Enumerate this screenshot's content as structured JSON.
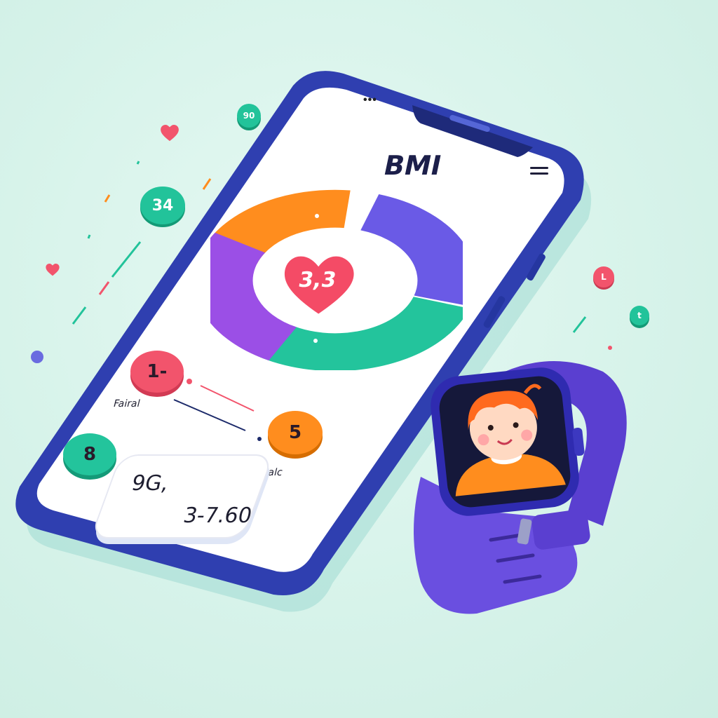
{
  "app": {
    "title": "BMI",
    "gauge_value": "3,3",
    "btn_left_top": "1-",
    "btn_right": "5",
    "btn_left_bottom": "8",
    "label_left": "Fairal",
    "label_right": "Ribalc",
    "readout_a": "9G,",
    "readout_b": "3-7.60"
  },
  "floaters": {
    "teal_small": "90",
    "teal_big": "34",
    "red_small": "L",
    "teal_right": "t"
  },
  "colors": {
    "background": "#daf5ec",
    "phone_frame": "#2f3fb0",
    "accent_orange": "#ff8d1e",
    "accent_purple": "#8b5be8",
    "accent_teal": "#23c49c",
    "accent_red": "#f2546c",
    "watch_band": "#6a4fe0"
  },
  "icons": [
    "heart-icon",
    "menu-icon",
    "status-dots-icon"
  ]
}
